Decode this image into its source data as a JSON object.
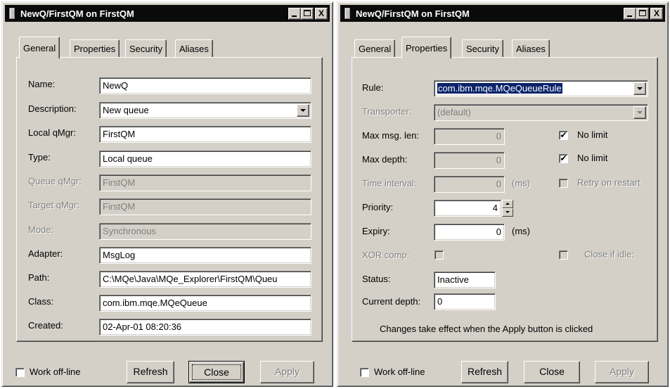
{
  "left_window": {
    "title": "NewQ/FirstQM on FirstQM",
    "tabs": [
      "General",
      "Properties",
      "Security",
      "Aliases"
    ],
    "active_tab": "General",
    "fields": {
      "name": {
        "label": "Name:",
        "value": "NewQ"
      },
      "description": {
        "label": "Description:",
        "value": "New queue"
      },
      "local_qmgr": {
        "label": "Local qMgr:",
        "value": "FirstQM"
      },
      "type": {
        "label": "Type:",
        "value": "Local queue"
      },
      "queue_qmgr": {
        "label": "Queue qMgr:",
        "value": "FirstQM"
      },
      "target_qmgr": {
        "label": "Target qMgr:",
        "value": "FirstQM"
      },
      "mode": {
        "label": "Mode:",
        "value": "Synchronous"
      },
      "adapter": {
        "label": "Adapter:",
        "value": "MsgLog"
      },
      "path": {
        "label": "Path:",
        "value": "C:\\MQe\\Java\\MQe_Explorer\\FirstQM\\Queu"
      },
      "class": {
        "label": "Class:",
        "value": "com.ibm.mqe.MQeQueue"
      },
      "created": {
        "label": "Created:",
        "value": "02-Apr-01 08:20:36"
      }
    },
    "work_offline": "Work off-line",
    "buttons": {
      "refresh": "Refresh",
      "close": "Close",
      "apply": "Apply"
    }
  },
  "right_window": {
    "title": "NewQ/FirstQM on FirstQM",
    "tabs": [
      "General",
      "Properties",
      "Security",
      "Aliases"
    ],
    "active_tab": "Properties",
    "fields": {
      "rule": {
        "label": "Rule:",
        "value": "com.ibm.mqe.MQeQueueRule"
      },
      "transporter": {
        "label": "Transporter:",
        "value": "(default)"
      },
      "max_msg_len": {
        "label": "Max msg. len:",
        "value": "0",
        "checkbox": "No limit",
        "checked": true
      },
      "max_depth": {
        "label": "Max depth:",
        "value": "0",
        "checkbox": "No limit",
        "checked": true
      },
      "time_interval": {
        "label": "Time interval:",
        "value": "0",
        "unit": "(ms)",
        "checkbox": "Retry on restart",
        "checked": false
      },
      "priority": {
        "label": "Priority:",
        "value": "4"
      },
      "expiry": {
        "label": "Expiry:",
        "value": "0",
        "unit": "(ms)"
      },
      "xor_comp": {
        "label": "XOR comp:",
        "checked": false
      },
      "close_if_idle": {
        "label": "Close if idle:",
        "checked": false
      },
      "status": {
        "label": "Status:",
        "value": "Inactive"
      },
      "current_depth": {
        "label": "Current depth:",
        "value": "0"
      }
    },
    "note": "Changes take effect when the Apply button is clicked",
    "work_offline": "Work off-line",
    "buttons": {
      "refresh": "Refresh",
      "close": "Close",
      "apply": "Apply"
    }
  },
  "glyphs": {
    "close": "X",
    "check": "✔"
  }
}
